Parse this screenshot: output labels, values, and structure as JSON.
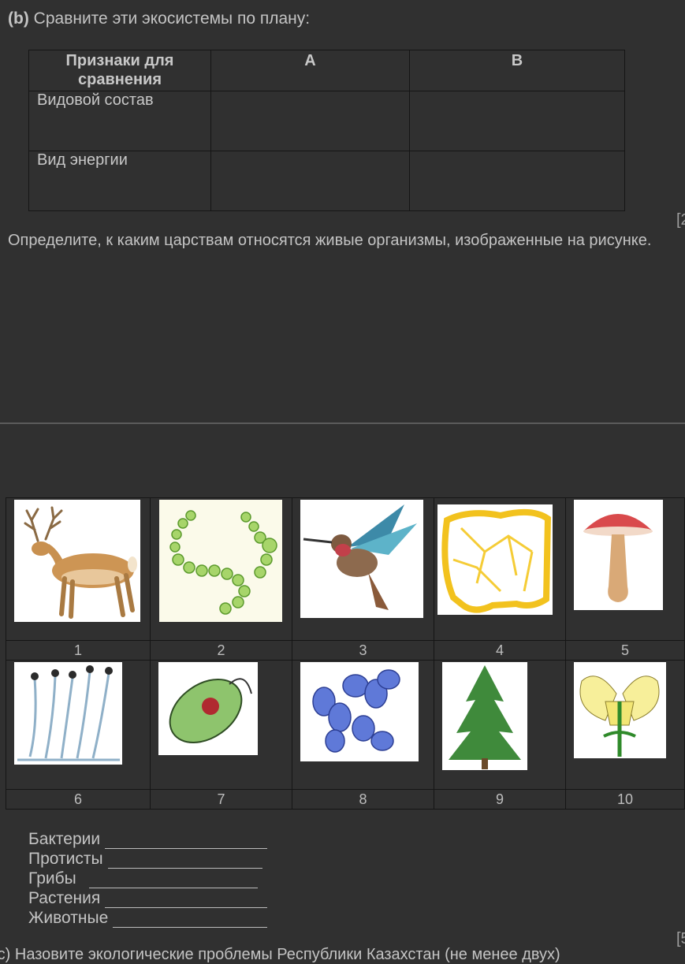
{
  "section_b": {
    "label": "(b)",
    "text": "Сравните эти экосистемы по плану:"
  },
  "comparison_table": {
    "headers": [
      "Признаки для сравнения",
      "А",
      "В"
    ],
    "rows": [
      "Видовой состав",
      "Вид энергии"
    ]
  },
  "marks": {
    "first": "[2",
    "second": "[5"
  },
  "question": {
    "text": "Определите, к каким царствам относятся живые организмы, изображенные на рисунке."
  },
  "organisms": {
    "numbers": [
      "1",
      "2",
      "3",
      "4",
      "5",
      "6",
      "7",
      "8",
      "9",
      "10"
    ],
    "icons": [
      "deer-icon",
      "algae-chain-icon",
      "hummingbird-icon",
      "slime-mold-icon",
      "mushroom-icon",
      "mold-sporangia-icon",
      "euglena-icon",
      "bacteria-cocci-icon",
      "fir-tree-icon",
      "flower-icon"
    ]
  },
  "answers": {
    "items": [
      "Бактерии",
      "Протисты",
      "Грибы",
      "Растения",
      "Животные"
    ]
  },
  "next_question": {
    "text": "(c) Назовите экологические проблемы Республики Казахстан (не менее двух)"
  }
}
